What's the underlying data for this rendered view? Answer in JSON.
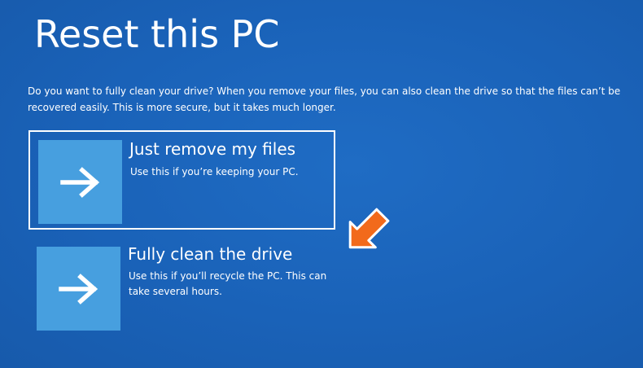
{
  "page": {
    "title": "Reset this PC",
    "description": "Do you want to fully clean your drive? When you remove your files, you can also clean the drive so that the files can’t be recovered easily. This is more secure, but it takes much longer."
  },
  "options": [
    {
      "title": "Just remove my files",
      "subtitle": "Use this if you’re keeping your PC.",
      "icon": "arrow-right-icon",
      "selected": true
    },
    {
      "title": "Fully clean the drive",
      "subtitle": "Use this if you’ll recycle the PC. This can take several hours.",
      "icon": "arrow-right-icon",
      "selected": false
    }
  ],
  "annotation": {
    "icon": "orange-arrow-pointer-icon"
  },
  "colors": {
    "background": "#1a62b8",
    "tile": "#479fdf",
    "text": "#ffffff",
    "pointer": "#f26a1b"
  }
}
